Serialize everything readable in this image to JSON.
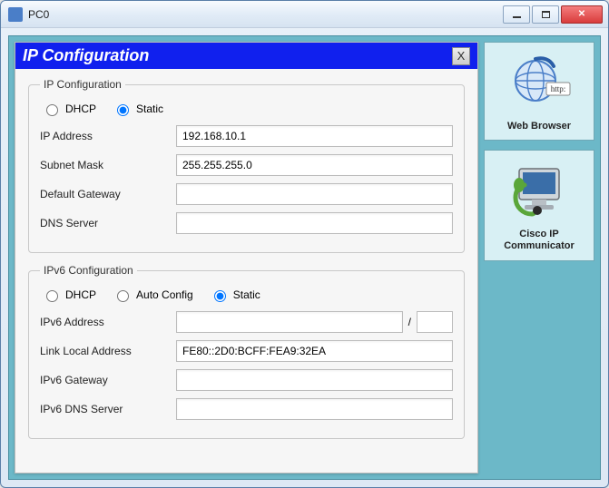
{
  "window": {
    "title": "PC0"
  },
  "dialog": {
    "title": "IP Configuration",
    "close_label": "X"
  },
  "ipv4": {
    "legend": "IP Configuration",
    "radio_dhcp": "DHCP",
    "radio_static": "Static",
    "selected": "static",
    "ip_label": "IP Address",
    "ip_value": "192.168.10.1",
    "subnet_label": "Subnet Mask",
    "subnet_value": "255.255.255.0",
    "gateway_label": "Default Gateway",
    "gateway_value": "",
    "dns_label": "DNS Server",
    "dns_value": ""
  },
  "ipv6": {
    "legend": "IPv6 Configuration",
    "radio_dhcp": "DHCP",
    "radio_auto": "Auto Config",
    "radio_static": "Static",
    "selected": "static",
    "addr_label": "IPv6 Address",
    "addr_value": "",
    "prefix_sep": "/",
    "prefix_value": "",
    "linklocal_label": "Link Local Address",
    "linklocal_value": "FE80::2D0:BCFF:FEA9:32EA",
    "gateway_label": "IPv6 Gateway",
    "gateway_value": "",
    "dns_label": "IPv6 DNS Server",
    "dns_value": ""
  },
  "apps": {
    "web_browser_label": "Web Browser",
    "cisco_ip_label": "Cisco IP Communicator"
  }
}
